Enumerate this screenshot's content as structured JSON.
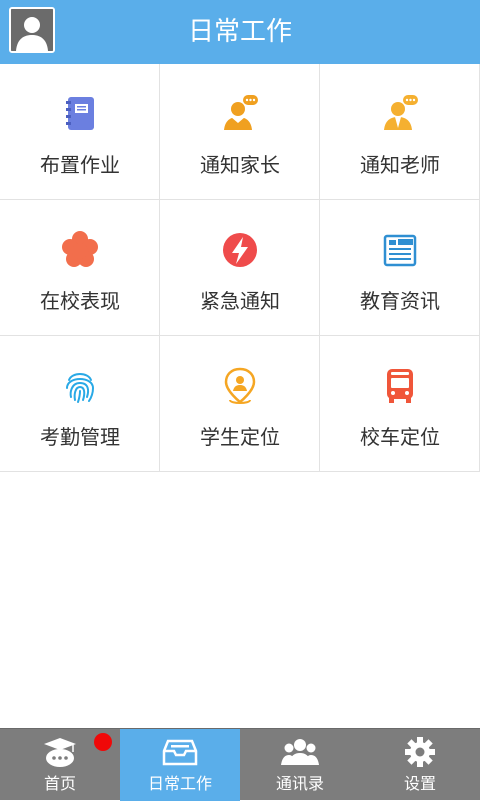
{
  "header": {
    "title": "日常工作",
    "avatar_icon": "user-avatar-icon"
  },
  "grid": {
    "items": [
      {
        "label": "布置作业",
        "icon": "notebook-icon",
        "color": "#6b7fe0"
      },
      {
        "label": "通知家长",
        "icon": "parent-chat-icon",
        "color": "#f0a020"
      },
      {
        "label": "通知老师",
        "icon": "teacher-chat-icon",
        "color": "#f5b030"
      },
      {
        "label": "在校表现",
        "icon": "flower-icon",
        "color": "#f26e4c"
      },
      {
        "label": "紧急通知",
        "icon": "lightning-icon",
        "color": "#ef4b4b"
      },
      {
        "label": "教育资讯",
        "icon": "newspaper-icon",
        "color": "#2f8fd2"
      },
      {
        "label": "考勤管理",
        "icon": "fingerprint-icon",
        "color": "#29a9e6"
      },
      {
        "label": "学生定位",
        "icon": "location-pin-icon",
        "color": "#f5a623"
      },
      {
        "label": "校车定位",
        "icon": "bus-icon",
        "color": "#f0563a"
      }
    ]
  },
  "tabbar": {
    "active_color": "#5aaeea",
    "badge_color": "#f00808",
    "tabs": [
      {
        "label": "首页",
        "icon": "graduation-cap-icon",
        "has_badge": true
      },
      {
        "label": "日常工作",
        "icon": "tray-icon",
        "active": true
      },
      {
        "label": "通讯录",
        "icon": "contacts-icon"
      },
      {
        "label": "设置",
        "icon": "gear-icon"
      }
    ]
  }
}
